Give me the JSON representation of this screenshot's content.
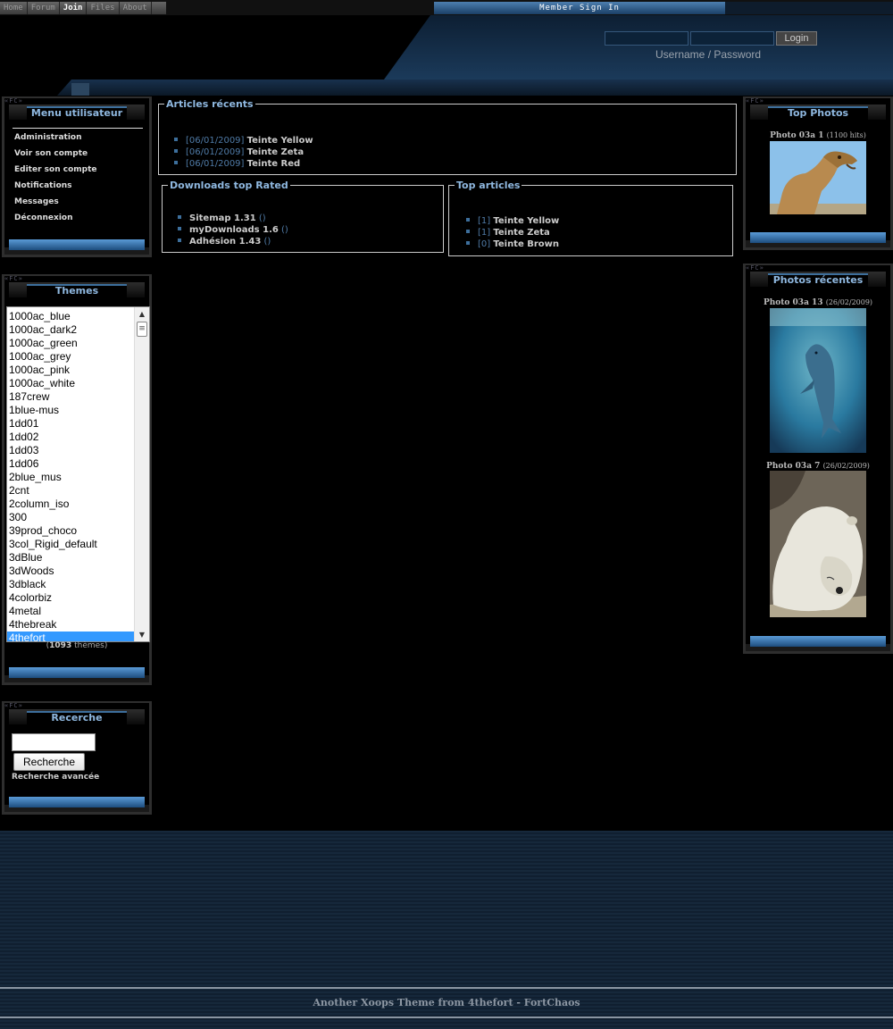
{
  "topnav": {
    "items": [
      {
        "label": "Home"
      },
      {
        "label": "Forum"
      },
      {
        "label": "Join"
      },
      {
        "label": "Files"
      },
      {
        "label": "About"
      }
    ],
    "signin_label": "Member Sign In"
  },
  "login": {
    "button_label": "Login",
    "username_label": "Username",
    "separator": " /  ",
    "password_label": "Password"
  },
  "menu_user": {
    "tag": "«FC»",
    "title": "Menu utilisateur",
    "items": [
      {
        "label": "Administration"
      },
      {
        "label": "Voir son compte"
      },
      {
        "label": "Editer son compte"
      },
      {
        "label": "Notifications"
      },
      {
        "label": "Messages"
      },
      {
        "label": "Déconnexion"
      }
    ]
  },
  "themes": {
    "tag": "«FC»",
    "title": "Themes",
    "options": [
      "1000ac_blue",
      "1000ac_dark2",
      "1000ac_green",
      "1000ac_grey",
      "1000ac_pink",
      "1000ac_white",
      "187crew",
      "1blue-mus",
      "1dd01",
      "1dd02",
      "1dd03",
      "1dd06",
      "2blue_mus",
      "2cnt",
      "2column_iso",
      "300",
      "39prod_choco",
      "3col_Rigid_default",
      "3dBlue",
      "3dWoods",
      "3dblack",
      "4colorbiz",
      "4metal",
      "4thebreak",
      "4thefort"
    ],
    "selected": "4thefort",
    "count_open": "(",
    "count": "1093",
    "count_label": " thèmes)"
  },
  "search": {
    "tag": "«FC»",
    "title": "Recerche",
    "input_value": "",
    "button_label": "Recherche",
    "advanced_label": "Recherche avancée"
  },
  "top_photos": {
    "tag": "«FC»",
    "title": "Top Photos",
    "photo": {
      "name": "Photo 03a 1",
      "meta": "(1100 hits)",
      "image": "camel"
    }
  },
  "recent_photos": {
    "tag": "«FC»",
    "title": "Photos récentes",
    "photos": [
      {
        "name": "Photo 03a 13",
        "meta": "(26/02/2009)",
        "image": "dolphin"
      },
      {
        "name": "Photo 03a 7",
        "meta": "(26/02/2009)",
        "image": "polar-bear"
      }
    ]
  },
  "articles_recents": {
    "title": "Articles récents",
    "items": [
      {
        "date": "[06/01/2009]",
        "title": "Teinte Yellow"
      },
      {
        "date": "[06/01/2009]",
        "title": "Teinte Zeta"
      },
      {
        "date": "[06/01/2009]",
        "title": "Teinte Red"
      }
    ]
  },
  "downloads_top": {
    "title": "Downloads top Rated",
    "items": [
      {
        "title": "Sitemap 1.31",
        "suffix": "()"
      },
      {
        "title": "myDownloads 1.6",
        "suffix": "()"
      },
      {
        "title": "Adhésion 1.43",
        "suffix": "()"
      }
    ]
  },
  "top_articles": {
    "title": "Top articles",
    "items": [
      {
        "rank": "[1]",
        "title": "Teinte Yellow"
      },
      {
        "rank": "[1]",
        "title": "Teinte Zeta"
      },
      {
        "rank": "[0]",
        "title": "Teinte Brown"
      }
    ]
  },
  "footer": {
    "text": "Another Xoops Theme from 4thefort - FortChaos"
  },
  "colors": {
    "accent": "#8fb8e0",
    "link_dim": "#4f7aa6",
    "selection": "#3399ff"
  }
}
